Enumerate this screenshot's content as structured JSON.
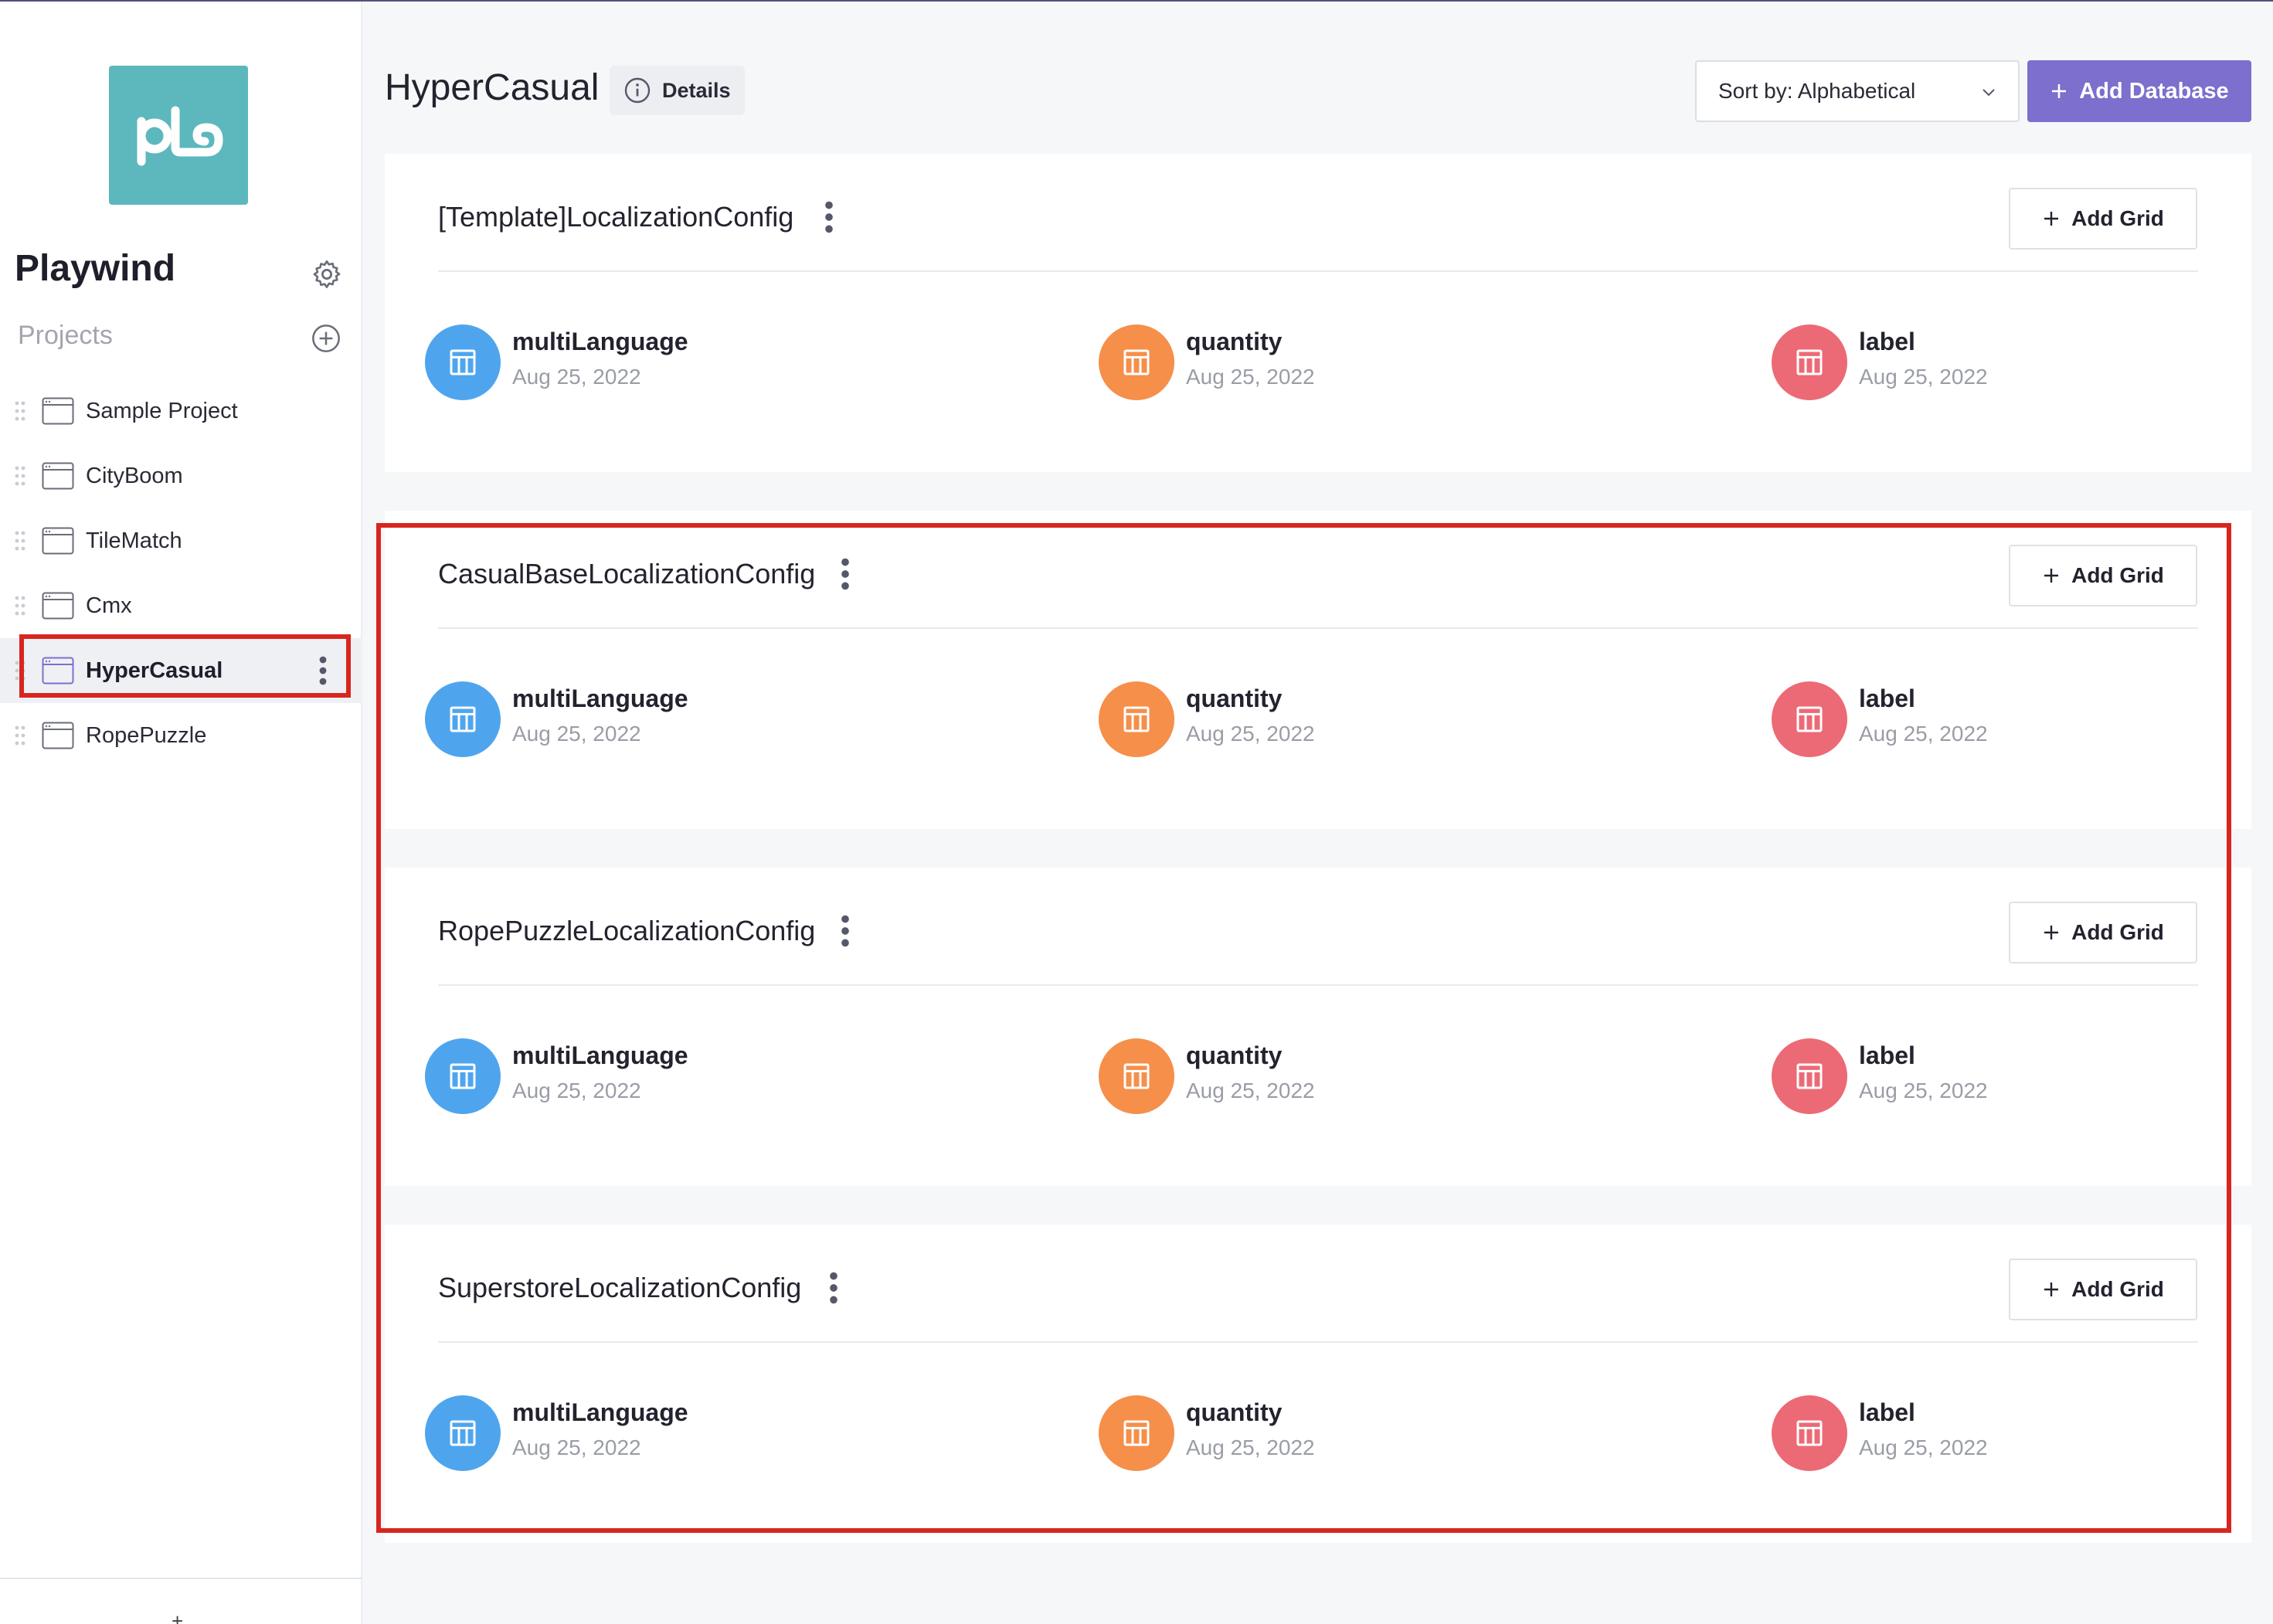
{
  "colors": {
    "accent": "#7c6fcd",
    "logo_bg": "#5cb8bd",
    "highlight": "#d8261f",
    "grid_blue": "#4ea5ee",
    "grid_orange": "#f58f4a",
    "grid_red": "#ec6a75"
  },
  "sidebar": {
    "org_name": "Playwind",
    "projects_label": "Projects",
    "projects": [
      {
        "label": "Sample Project"
      },
      {
        "label": "CityBoom"
      },
      {
        "label": "TileMatch"
      },
      {
        "label": "Cmx"
      },
      {
        "label": "HyperCasual",
        "active": true
      },
      {
        "label": "RopePuzzle"
      }
    ],
    "bottom_icon": "+"
  },
  "header": {
    "title": "HyperCasual",
    "details_label": "Details",
    "sort_label": "Sort by: Alphabetical",
    "add_database_label": "Add Database"
  },
  "databases": [
    {
      "name": "[Template]LocalizationConfig",
      "add_grid_label": "Add Grid",
      "grids": [
        {
          "name": "multiLanguage",
          "date": "Aug 25, 2022"
        },
        {
          "name": "quantity",
          "date": "Aug 25, 2022"
        },
        {
          "name": "label",
          "date": "Aug 25, 2022"
        }
      ]
    },
    {
      "name": "CasualBaseLocalizationConfig",
      "add_grid_label": "Add Grid",
      "grids": [
        {
          "name": "multiLanguage",
          "date": "Aug 25, 2022"
        },
        {
          "name": "quantity",
          "date": "Aug 25, 2022"
        },
        {
          "name": "label",
          "date": "Aug 25, 2022"
        }
      ]
    },
    {
      "name": "RopePuzzleLocalizationConfig",
      "add_grid_label": "Add Grid",
      "grids": [
        {
          "name": "multiLanguage",
          "date": "Aug 25, 2022"
        },
        {
          "name": "quantity",
          "date": "Aug 25, 2022"
        },
        {
          "name": "label",
          "date": "Aug 25, 2022"
        }
      ]
    },
    {
      "name": "SuperstoreLocalizationConfig",
      "add_grid_label": "Add Grid",
      "grids": [
        {
          "name": "multiLanguage",
          "date": "Aug 25, 2022"
        },
        {
          "name": "quantity",
          "date": "Aug 25, 2022"
        },
        {
          "name": "label",
          "date": "Aug 25, 2022"
        }
      ]
    }
  ]
}
